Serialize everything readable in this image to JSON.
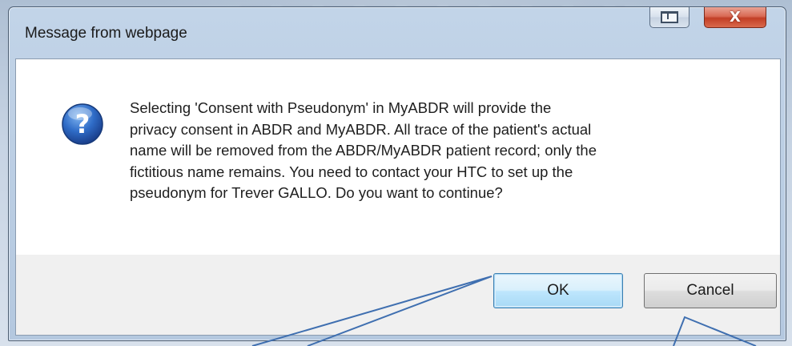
{
  "dialog": {
    "title": "Message from webpage",
    "restore_button": {
      "icon": "restore-icon"
    },
    "close_button": {
      "label": "X",
      "icon": "close-icon",
      "color": "#c94a33"
    },
    "icon": "question-icon",
    "message": "Selecting 'Consent with Pseudonym' in MyABDR will provide the\nprivacy consent in ABDR and MyABDR. All trace of the patient's actual\nname will be removed from the ABDR/MyABDR patient record; only the\nfictitious name remains. You need to contact your HTC to set up the\npseudonym for Trever GALLO. Do you want to continue?",
    "buttons": {
      "ok_label": "OK",
      "cancel_label": "Cancel"
    }
  },
  "colors": {
    "accent": "#3c7fb1",
    "annotation_line": "#3f6fb0"
  }
}
